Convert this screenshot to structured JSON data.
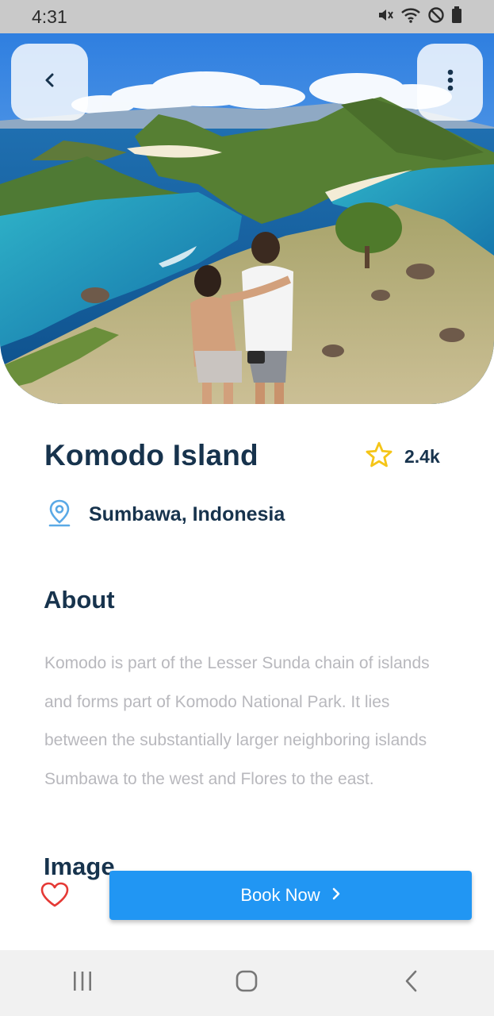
{
  "status_bar": {
    "time": "4:31"
  },
  "place": {
    "title": "Komodo Island",
    "rating": "2.4k",
    "location": "Sumbawa, Indonesia"
  },
  "about": {
    "heading": "About",
    "text": "Komodo is part of the Lesser Sunda chain of islands and forms part of Komodo National Park. It lies between the substantially larger neighboring islands Sumbawa to the west and Flores to the east."
  },
  "image_section": {
    "heading": "Image"
  },
  "actions": {
    "book_label": "Book Now"
  },
  "colors": {
    "accent": "#2196f3",
    "heading": "#17334d",
    "star": "#f5c518",
    "heart": "#e53935",
    "body_text": "#b8b8bd"
  },
  "icons": [
    "back-icon",
    "more-vert-icon",
    "star-icon",
    "location-pin-icon",
    "heart-icon",
    "chevron-right-icon",
    "recent-apps-icon",
    "home-icon",
    "nav-back-icon",
    "mute-icon",
    "wifi-icon",
    "dnd-icon",
    "battery-icon"
  ]
}
